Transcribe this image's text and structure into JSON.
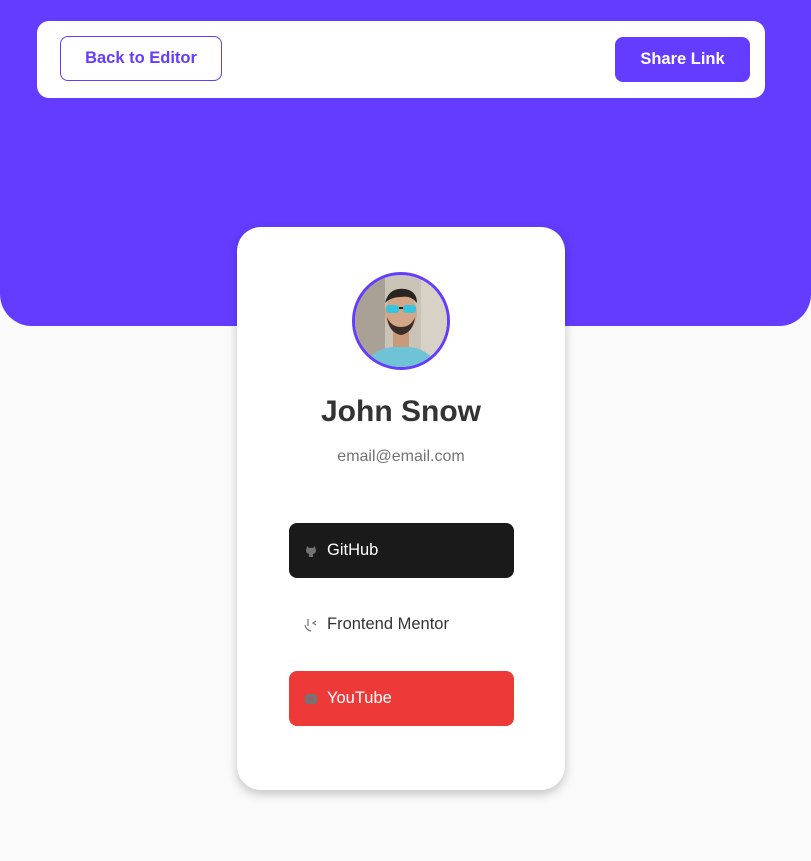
{
  "header": {
    "back_label": "Back to Editor",
    "share_label": "Share Link"
  },
  "profile": {
    "name": "John Snow",
    "email": "email@email.com"
  },
  "links": [
    {
      "label": "GitHub",
      "icon": "github-icon",
      "bg": "#1a1a1a",
      "color": "#ffffff"
    },
    {
      "label": "Frontend Mentor",
      "icon": "frontend-mentor-icon",
      "bg": "#ffffff",
      "color": "#333333"
    },
    {
      "label": "YouTube",
      "icon": "youtube-icon",
      "bg": "#ee3939",
      "color": "#ffffff"
    }
  ],
  "colors": {
    "accent": "#633cff",
    "background": "#fafafa"
  }
}
